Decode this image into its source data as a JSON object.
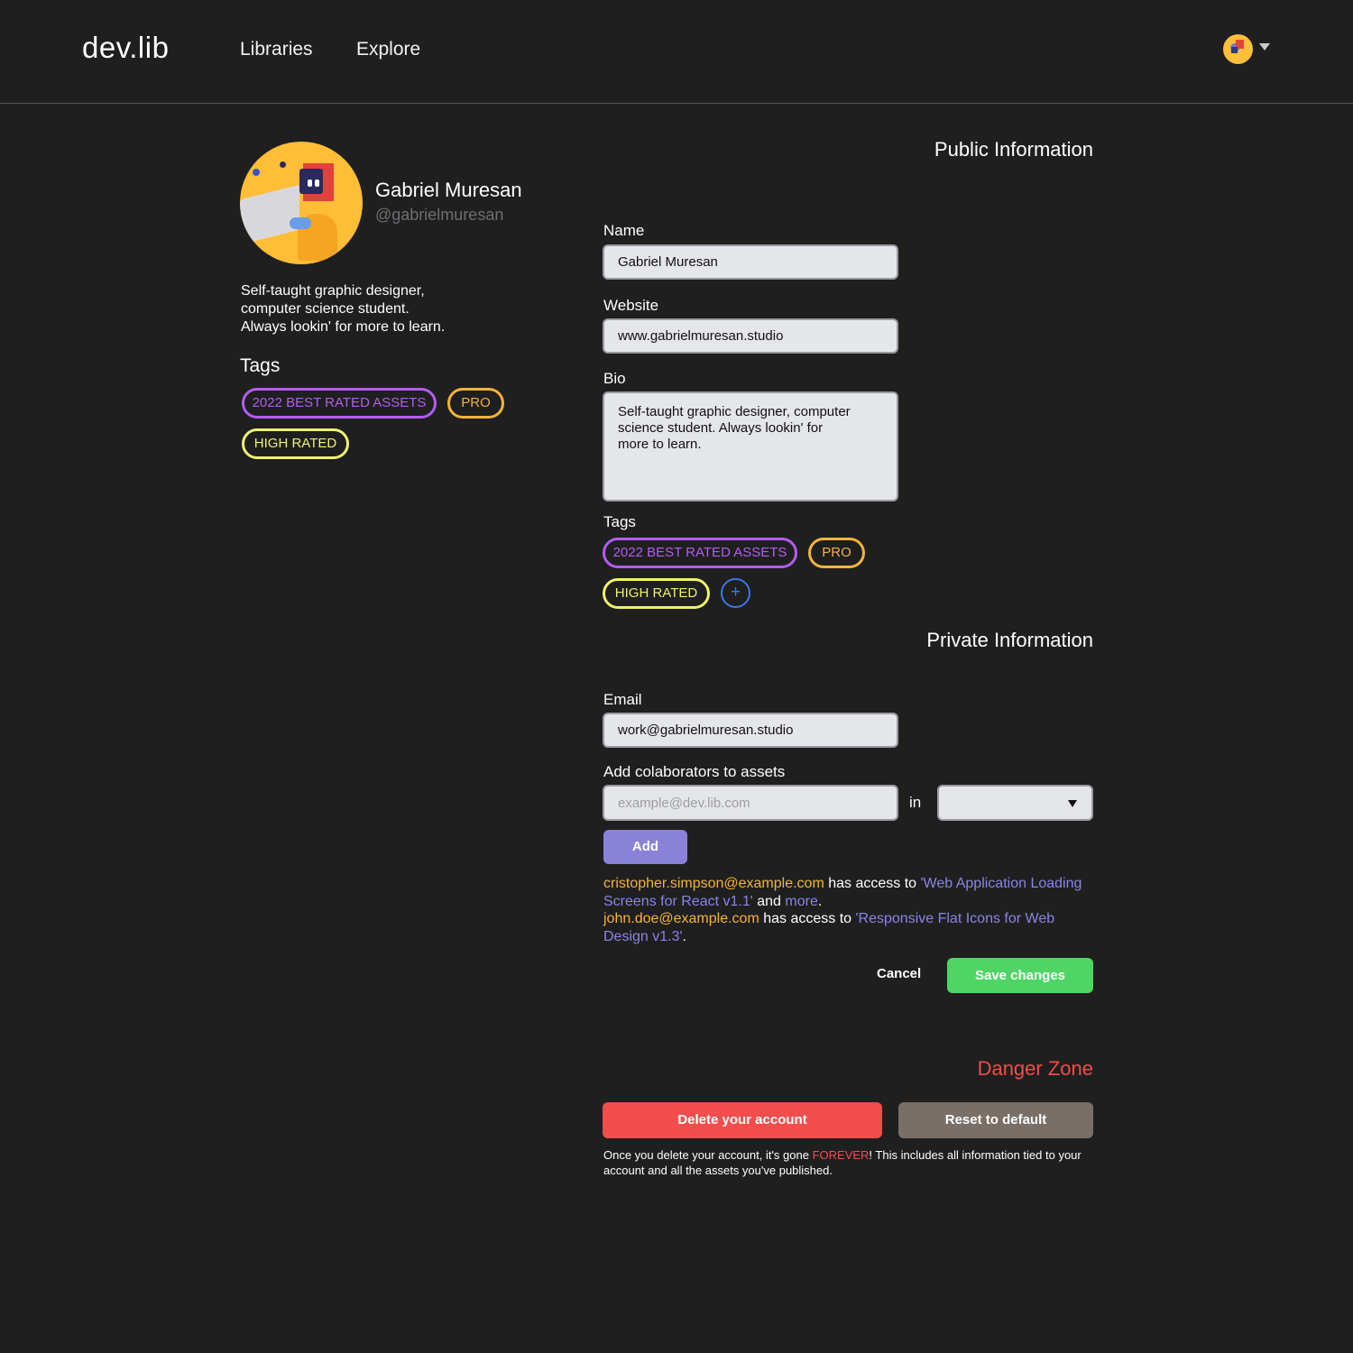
{
  "header": {
    "logo": "dev.lib",
    "nav": [
      "Libraries",
      "Explore"
    ]
  },
  "profile": {
    "name": "Gabriel Muresan",
    "handle": "@gabrielmuresan",
    "bio_lines": [
      "Self-taught graphic designer,",
      "computer science student.",
      "Always lookin' for more to learn."
    ],
    "tags_heading": "Tags",
    "tags": [
      "2022 BEST RATED ASSETS",
      "PRO",
      "HIGH RATED"
    ]
  },
  "public_info": {
    "title": "Public Information",
    "name_label": "Name",
    "name_value": "Gabriel Muresan",
    "website_label": "Website",
    "website_value": "www.gabrielmuresan.studio",
    "bio_label": "Bio",
    "bio_value": "Self-taught graphic designer, computer science student. Always lookin' for more to learn.",
    "tags_label": "Tags",
    "tags": [
      "2022 BEST RATED ASSETS",
      "PRO",
      "HIGH RATED"
    ],
    "add_tag_symbol": "+"
  },
  "private_info": {
    "title": "Private Information",
    "email_label": "Email",
    "email_value": "work@gabrielmuresan.studio",
    "collab_label": "Add colaborators to assets",
    "collab_placeholder": "example@dev.lib.com",
    "in_label": "in",
    "add_button": "Add",
    "access": [
      {
        "email": "cristopher.simpson@example.com",
        "has_access": " has access to ",
        "asset": "'Web Application Loading Screens for React v1.1'",
        "and": " and ",
        "more": "more",
        "end": "."
      },
      {
        "email": "john.doe@example.com",
        "has_access": " has access to ",
        "asset": "'Responsive Flat Icons for Web Design v1.3'",
        "end": "."
      }
    ],
    "cancel_button": "Cancel",
    "save_button": "Save changes"
  },
  "danger_zone": {
    "title": "Danger Zone",
    "delete_button": "Delete your account",
    "reset_button": "Reset to default",
    "warning_before": "Once you delete your account, it's gone ",
    "warning_emphasis": "FOREVER",
    "warning_after": "! This includes all information tied to your account and all the assets you've published."
  },
  "colors": {
    "background": "#1f1f20",
    "tag_purple": "#b45df0",
    "tag_orange": "#f3b43a",
    "tag_yellow": "#eef26f",
    "add_button": "#8a81d9",
    "save_button": "#4fd565",
    "delete_button": "#f34d4c",
    "reset_button": "#7a6f67",
    "link": "#8c84e6",
    "danger": "#ef4d4a"
  }
}
